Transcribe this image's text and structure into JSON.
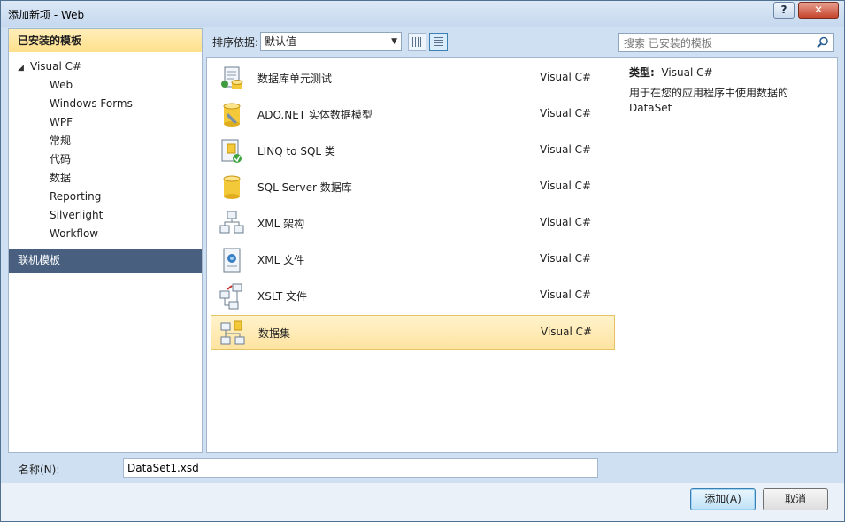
{
  "window": {
    "title": "添加新项 - Web",
    "help_label": "?",
    "close_label": "✕"
  },
  "left": {
    "header": "已安装的模板",
    "root": "Visual C#",
    "items": [
      "Web",
      "Windows Forms",
      "WPF",
      "常规",
      "代码",
      "数据",
      "Reporting",
      "Silverlight",
      "Workflow"
    ],
    "online": "联机模板"
  },
  "toolbar": {
    "sort_label": "排序依据:",
    "sort_value": "默认值",
    "search_placeholder": "搜索 已安装的模板"
  },
  "templates": [
    {
      "name": "数据库单元测试",
      "lang": "Visual C#",
      "icon": "database-unit-test-icon"
    },
    {
      "name": "ADO.NET 实体数据模型",
      "lang": "Visual C#",
      "icon": "entity-model-icon"
    },
    {
      "name": "LINQ to SQL 类",
      "lang": "Visual C#",
      "icon": "linq-to-sql-icon"
    },
    {
      "name": "SQL Server 数据库",
      "lang": "Visual C#",
      "icon": "sql-database-icon"
    },
    {
      "name": "XML 架构",
      "lang": "Visual C#",
      "icon": "xml-schema-icon"
    },
    {
      "name": "XML 文件",
      "lang": "Visual C#",
      "icon": "xml-file-icon"
    },
    {
      "name": "XSLT 文件",
      "lang": "Visual C#",
      "icon": "xslt-file-icon"
    },
    {
      "name": "数据集",
      "lang": "Visual C#",
      "icon": "dataset-icon",
      "selected": true
    }
  ],
  "detail": {
    "type_label": "类型:",
    "type_value": "Visual C#",
    "description": "用于在您的应用程序中使用数据的 DataSet"
  },
  "bottom": {
    "name_label": "名称(N):",
    "name_value": "DataSet1.xsd",
    "add_label": "添加(A)",
    "cancel_label": "取消"
  },
  "colors": {
    "selection": "#ffe3a0",
    "online_bar": "#485f7f",
    "header": "#ffe08b"
  }
}
